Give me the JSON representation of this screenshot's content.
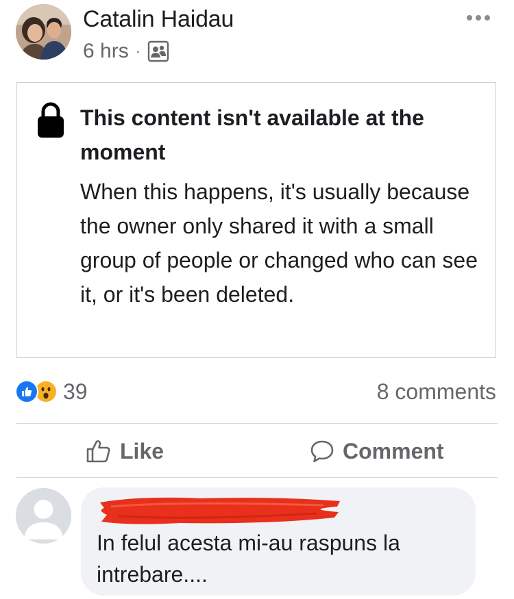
{
  "post": {
    "author": "Catalin Haidau",
    "time": "6 hrs",
    "separator": "·",
    "audience_icon": "friends-group-icon"
  },
  "notice": {
    "title": "This content isn't available at the moment",
    "body": "When this happens, it's usually because the owner only shared it with a small group of people or changed who can see it, or it's been deleted.",
    "icon": "lock-icon"
  },
  "stats": {
    "reaction_count": "39",
    "reactions": [
      "like",
      "wow"
    ],
    "comments": "8 comments"
  },
  "actions": {
    "like": "Like",
    "comment": "Comment"
  },
  "comment": {
    "text": "In felul acesta mi-au raspuns la intrebare...."
  },
  "colors": {
    "like_blue": "#1877f2",
    "wow_yellow": "#f7b125",
    "redaction_red": "#e8301c",
    "muted_text": "#65676b"
  }
}
